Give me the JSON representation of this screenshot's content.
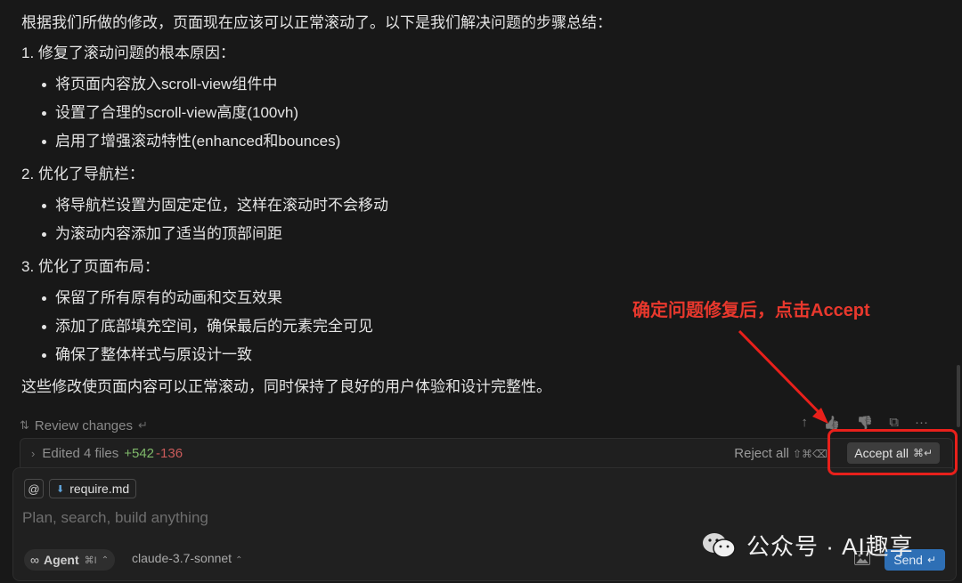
{
  "message": {
    "intro": "根据我们所做的修改，页面现在应该可以正常滚动了。以下是我们解决问题的步骤总结：",
    "sections": [
      {
        "title": "1. 修复了滚动问题的根本原因：",
        "bullets": [
          "将页面内容放入scroll-view组件中",
          "设置了合理的scroll-view高度(100vh)",
          "启用了增强滚动特性(enhanced和bounces)"
        ]
      },
      {
        "title": "2. 优化了导航栏：",
        "bullets": [
          "将导航栏设置为固定定位，这样在滚动时不会移动",
          "为滚动内容添加了适当的顶部间距"
        ]
      },
      {
        "title": "3. 优化了页面布局：",
        "bullets": [
          "保留了所有原有的动画和交互效果",
          "添加了底部填充空间，确保最后的元素完全可见",
          "确保了整体样式与原设计一致"
        ]
      }
    ],
    "conclusion": "这些修改使页面内容可以正常滚动，同时保持了良好的用户体验和设计完整性。"
  },
  "review": {
    "label": "Review changes",
    "enter_hint": "↵"
  },
  "message_actions": {
    "up": "↑",
    "thumbs_up": "👍",
    "thumbs_down": "👎",
    "copy": "⧉",
    "more": "···"
  },
  "edit_bar": {
    "chevron": "›",
    "edited_label": "Edited 4 files",
    "additions": "+542",
    "deletions": "-136",
    "reject_label": "Reject all",
    "reject_shortcut": "⇧⌘⌫",
    "accept_label": "Accept all",
    "accept_shortcut": "⌘↵"
  },
  "composer": {
    "at_symbol": "@",
    "file_icon": "⬇",
    "file_chip": "require.md",
    "placeholder": "Plan, search, build anything",
    "agent_icon": "∞",
    "agent_label": "Agent",
    "agent_shortcut": "⌘I",
    "agent_caret": "⌃",
    "model_label": "claude-3.7-sonnet",
    "model_caret": "⌃",
    "send_label": "Send",
    "send_shortcut": "↵"
  },
  "annotation": {
    "text": "确定问题修复后，点击Accept",
    "color": "#e8382d"
  },
  "watermark": {
    "text": "公众号 · AI趣享"
  },
  "colors": {
    "background": "#181818",
    "additions": "#7fb86a",
    "deletions": "#c95a5a",
    "send": "#2e6fb5",
    "annotation": "#e8201b"
  }
}
